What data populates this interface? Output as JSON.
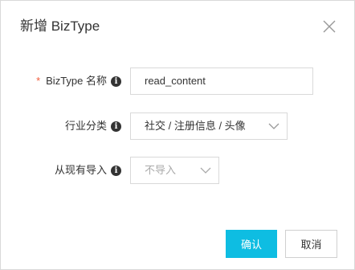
{
  "dialog": {
    "title": "新增 BizType",
    "close_icon": "close-icon"
  },
  "form": {
    "biztype": {
      "required_mark": "*",
      "label": "BizType 名称",
      "info_icon": "i",
      "value": "read_content"
    },
    "industry": {
      "label": "行业分类",
      "info_icon": "i",
      "selected": "社交 / 注册信息 / 头像"
    },
    "import_from": {
      "label": "从现有导入",
      "info_icon": "i",
      "selected": "不导入"
    }
  },
  "footer": {
    "ok_label": "确认",
    "cancel_label": "取消"
  },
  "colors": {
    "primary": "#0ebde2",
    "required": "#f25c3b",
    "border": "#d9d9d9"
  }
}
